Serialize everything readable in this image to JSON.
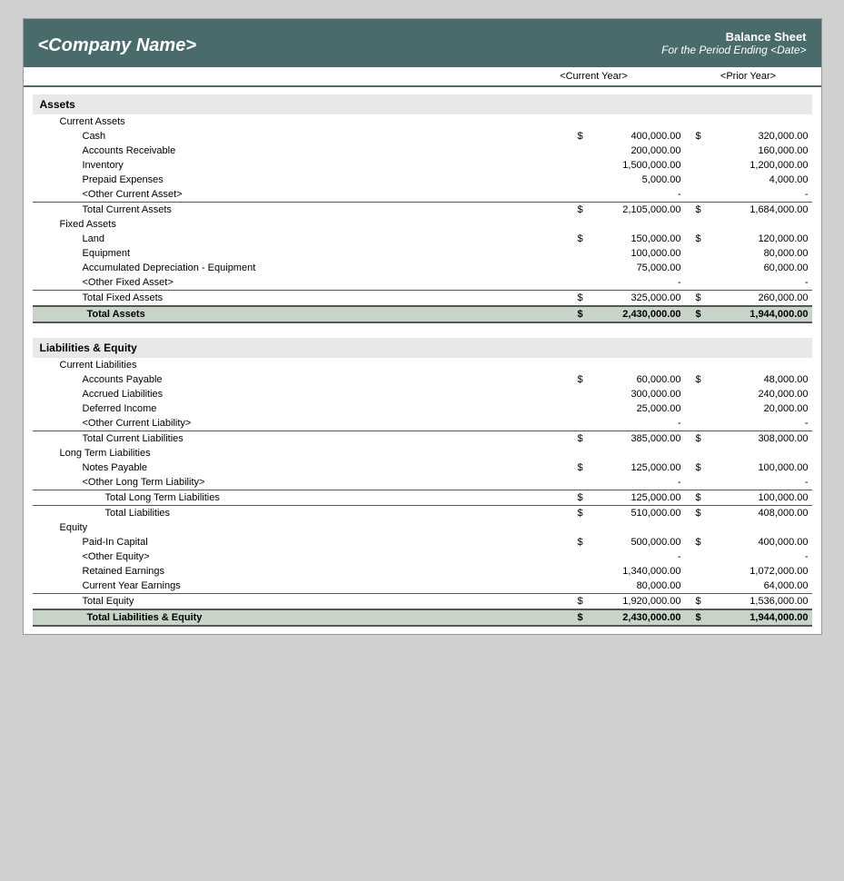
{
  "header": {
    "company": "<Company Name>",
    "title": "Balance Sheet",
    "subtitle": "For the Period Ending <Date>"
  },
  "columns": {
    "current": "<Current Year>",
    "prior": "<Prior Year>"
  },
  "assets": {
    "label": "Assets",
    "current_assets": {
      "label": "Current Assets",
      "items": [
        {
          "label": "Cash",
          "current": "400,000.00",
          "prior": "320,000.00",
          "has_dollar": true
        },
        {
          "label": "Accounts Receivable",
          "current": "200,000.00",
          "prior": "160,000.00",
          "has_dollar": false
        },
        {
          "label": "Inventory",
          "current": "1,500,000.00",
          "prior": "1,200,000.00",
          "has_dollar": false
        },
        {
          "label": "Prepaid Expenses",
          "current": "5,000.00",
          "prior": "4,000.00",
          "has_dollar": false
        },
        {
          "label": "<Other Current Asset>",
          "current": "-",
          "prior": "-",
          "has_dollar": false
        }
      ],
      "total_label": "Total Current Assets",
      "total_current": "2,105,000.00",
      "total_prior": "1,684,000.00"
    },
    "fixed_assets": {
      "label": "Fixed Assets",
      "items": [
        {
          "label": "Land",
          "current": "150,000.00",
          "prior": "120,000.00",
          "has_dollar": true
        },
        {
          "label": "Equipment",
          "current": "100,000.00",
          "prior": "80,000.00",
          "has_dollar": false
        },
        {
          "label": "Accumulated Depreciation - Equipment",
          "current": "75,000.00",
          "prior": "60,000.00",
          "has_dollar": false
        },
        {
          "label": "<Other Fixed Asset>",
          "current": "-",
          "prior": "-",
          "has_dollar": false
        }
      ],
      "total_label": "Total Fixed Assets",
      "total_current": "325,000.00",
      "total_prior": "260,000.00"
    },
    "total_label": "Total Assets",
    "total_current": "2,430,000.00",
    "total_prior": "1,944,000.00"
  },
  "liabilities_equity": {
    "label": "Liabilities & Equity",
    "current_liabilities": {
      "label": "Current Liabilities",
      "items": [
        {
          "label": "Accounts Payable",
          "current": "60,000.00",
          "prior": "48,000.00",
          "has_dollar": true
        },
        {
          "label": "Accrued Liabilities",
          "current": "300,000.00",
          "prior": "240,000.00",
          "has_dollar": false
        },
        {
          "label": "Deferred Income",
          "current": "25,000.00",
          "prior": "20,000.00",
          "has_dollar": false
        },
        {
          "label": "<Other Current Liability>",
          "current": "-",
          "prior": "-",
          "has_dollar": false
        }
      ],
      "total_label": "Total Current Liabilities",
      "total_current": "385,000.00",
      "total_prior": "308,000.00"
    },
    "long_term_liabilities": {
      "label": "Long Term Liabilities",
      "items": [
        {
          "label": "Notes Payable",
          "current": "125,000.00",
          "prior": "100,000.00",
          "has_dollar": true
        },
        {
          "label": "<Other Long Term Liability>",
          "current": "-",
          "prior": "-",
          "has_dollar": false
        }
      ],
      "total_lt_label": "Total Long Term Liabilities",
      "total_lt_current": "125,000.00",
      "total_lt_prior": "100,000.00",
      "total_label": "Total Liabilities",
      "total_current": "510,000.00",
      "total_prior": "408,000.00"
    },
    "equity": {
      "label": "Equity",
      "items": [
        {
          "label": "Paid-In Capital",
          "current": "500,000.00",
          "prior": "400,000.00",
          "has_dollar": true
        },
        {
          "label": "<Other Equity>",
          "current": "-",
          "prior": "-",
          "has_dollar": false
        },
        {
          "label": "Retained Earnings",
          "current": "1,340,000.00",
          "prior": "1,072,000.00",
          "has_dollar": false
        },
        {
          "label": "Current Year Earnings",
          "current": "80,000.00",
          "prior": "64,000.00",
          "has_dollar": false
        }
      ],
      "total_label": "Total Equity",
      "total_current": "1,920,000.00",
      "total_prior": "1,536,000.00"
    },
    "total_label": "Total Liabilities & Equity",
    "total_current": "2,430,000.00",
    "total_prior": "1,944,000.00"
  }
}
